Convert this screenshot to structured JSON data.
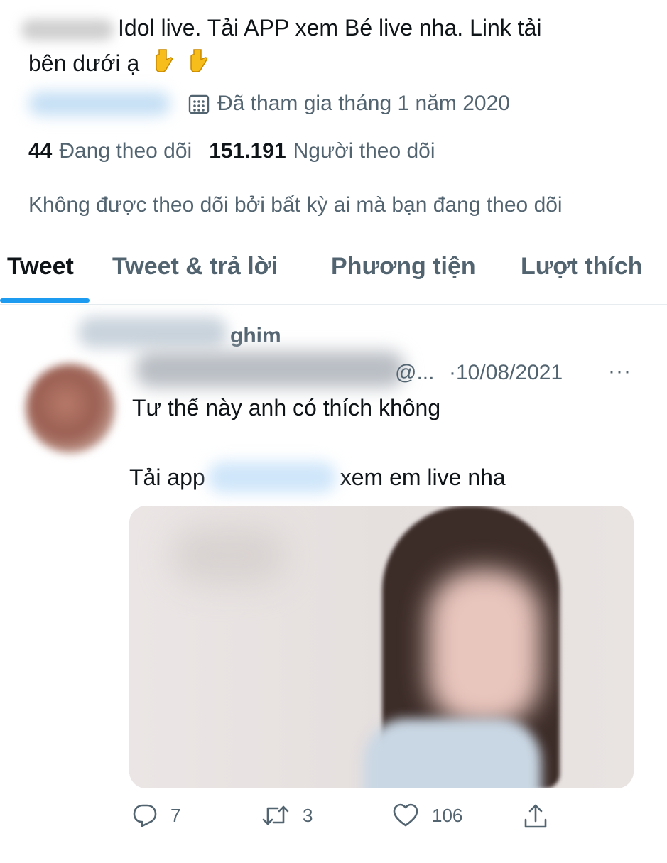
{
  "profile": {
    "bio_line1": "Idol live. Tải APP xem Bé live nha. Link tải",
    "bio_line2": "bên dưới ạ",
    "emoji_icon": "backhand-index-pointing-down",
    "joined": "Đã tham gia tháng 1 năm 2020",
    "following_count": "44",
    "following_label": "Đang theo dõi",
    "followers_count": "151.191",
    "followers_label": "Người theo dõi",
    "not_followed_note": "Không được theo dõi bởi bất kỳ ai mà bạn đang theo dõi"
  },
  "tabs": [
    {
      "label": "Tweet",
      "active": true
    },
    {
      "label": "Tweet & trả lời",
      "active": false
    },
    {
      "label": "Phương tiện",
      "active": false
    },
    {
      "label": "Lượt thích",
      "active": false
    }
  ],
  "tweet": {
    "pinned_label": "ghim",
    "handle": "@...",
    "date": "·10/08/2021",
    "more": "···",
    "text_line1": "Tư thế này anh có thích không",
    "text_line2_start": "Tải app",
    "text_line2_end": "xem em live nha",
    "reply_count": "7",
    "retweet_count": "3",
    "like_count": "106"
  },
  "colors": {
    "accent": "#1d9bf0",
    "secondary_text": "#536471",
    "primary_text": "#0f1419"
  }
}
